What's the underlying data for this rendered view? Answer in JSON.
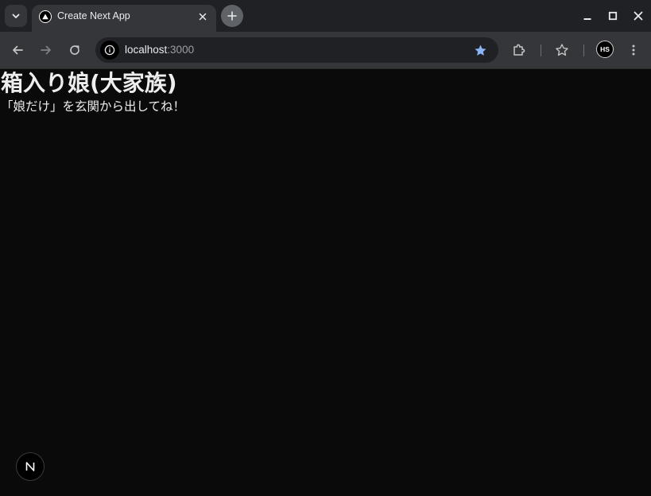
{
  "browser": {
    "tab": {
      "title": "Create Next App"
    },
    "address": {
      "host": "localhost",
      "port": ":3000"
    },
    "profile": {
      "initials": "HS"
    }
  },
  "page": {
    "heading": "箱入り娘(大家族)",
    "subtitle": "「娘だけ」を玄関から出してね！"
  },
  "colors": {
    "page_bg": "#0a0a0a",
    "text": "#ededed",
    "chrome_frame": "#202124",
    "chrome_toolbar": "#35363a",
    "star_active": "#8ab4f8"
  },
  "icons": {
    "tab_search": "chevron-down-icon",
    "favicon": "nextjs-triangle-icon",
    "tab_close": "close-icon",
    "new_tab": "plus-icon",
    "minimize": "minimize-icon",
    "maximize": "maximize-icon",
    "close_window": "close-icon",
    "back": "arrow-left-icon",
    "forward": "arrow-right-icon",
    "reload": "reload-icon",
    "site_info": "info-icon",
    "bookmark": "star-filled-icon",
    "extensions": "puzzle-icon",
    "bookmarks_panel": "star-outline-icon",
    "menu": "kebab-menu-icon",
    "next_badge": "nextjs-n-icon"
  }
}
